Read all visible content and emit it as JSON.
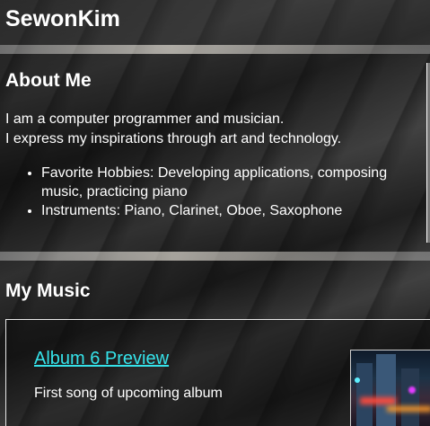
{
  "header": {
    "site_title": "SewonKim"
  },
  "about": {
    "title": "About Me",
    "intro_line1": "I am a computer programmer and musician.",
    "intro_line2": "I express my inspirations through art and technology.",
    "list": [
      "Favorite Hobbies: Developing applications, composing music, practicing piano",
      "Instruments: Piano, Clarinet, Oboe, Saxophone"
    ]
  },
  "music": {
    "title": "My Music",
    "albums": [
      {
        "link_label": "Album 6 Preview",
        "description": "First song of upcoming album"
      }
    ]
  },
  "colors": {
    "link": "#35e3ea",
    "text": "#ffffff"
  }
}
